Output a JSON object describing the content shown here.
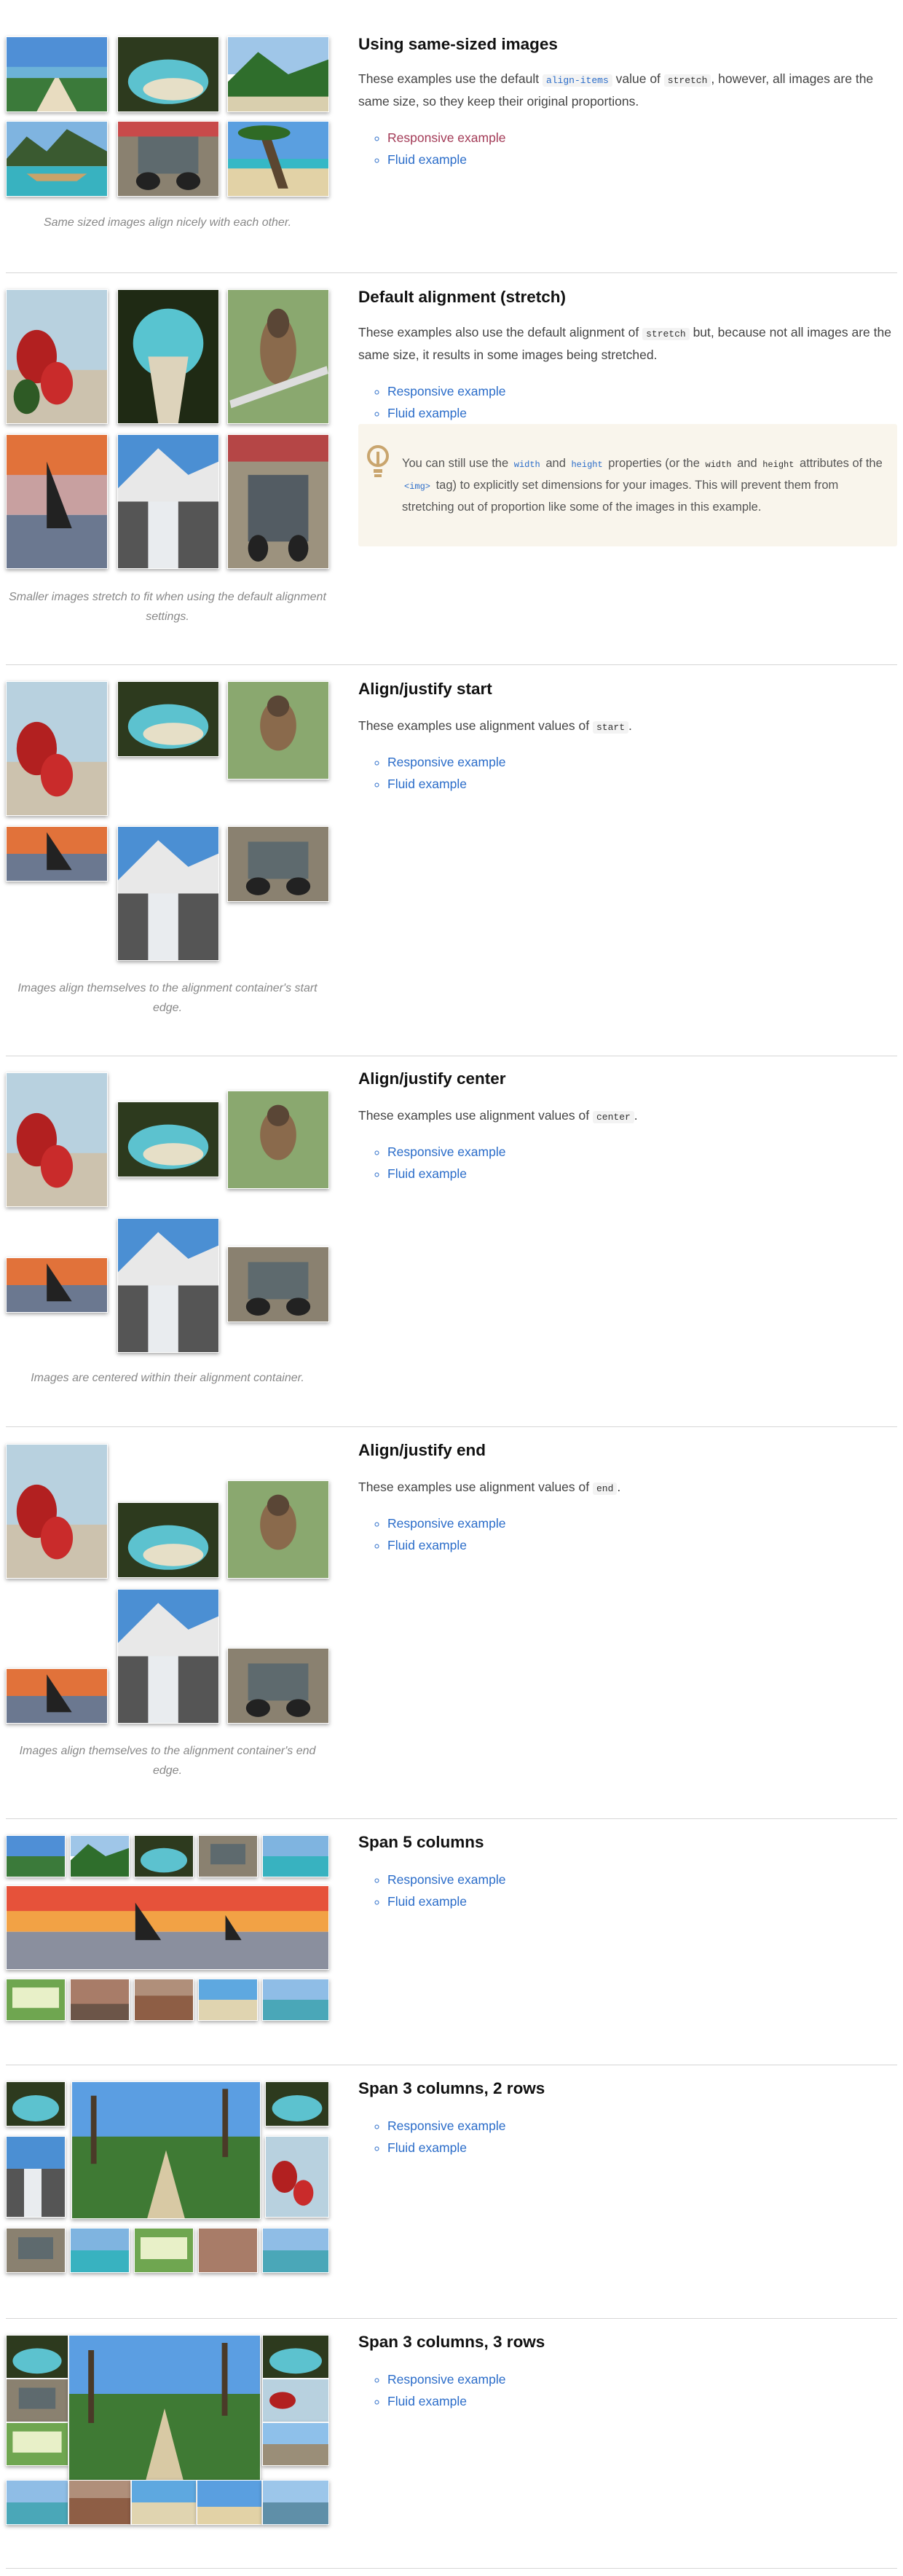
{
  "sections": [
    {
      "title": "Using same-sized images",
      "desc_pre": "These examples use the default ",
      "desc_code1": "align-items",
      "desc_mid": " value of ",
      "desc_code2": "stretch",
      "desc_post": ", however, all images are the same size, so they keep their original proportions.",
      "links": [
        "Responsive example",
        "Fluid example"
      ],
      "caption": "Same sized images align nicely with each other."
    },
    {
      "title": "Default alignment (stretch)",
      "desc_pre": "These examples also use the default alignment of ",
      "desc_code1": "stretch",
      "desc_post": " but, because not all images are the same size, it results in some images being stretched.",
      "links": [
        "Responsive example",
        "Fluid example"
      ],
      "note": {
        "pre": "You can still use the ",
        "c1": "width",
        "m1": " and ",
        "c2": "height",
        "m2": " properties (or the ",
        "c3": "width",
        "m3": " and ",
        "c4": "height",
        "m4": " attributes of the ",
        "c5": "<img>",
        "post": " tag) to explicitly set dimensions for your images. This will prevent them from stretching out of proportion like some of the images in this example."
      },
      "caption": "Smaller images stretch to fit when using the default alignment settings."
    },
    {
      "title": "Align/justify start",
      "desc_pre": "These examples use alignment values of ",
      "desc_code1": "start",
      "desc_post": ".",
      "links": [
        "Responsive example",
        "Fluid example"
      ],
      "caption": "Images align themselves to the alignment container's start edge."
    },
    {
      "title": "Align/justify center",
      "desc_pre": "These examples use alignment values of ",
      "desc_code1": "center",
      "desc_post": ".",
      "links": [
        "Responsive example",
        "Fluid example"
      ],
      "caption": "Images are centered within their alignment container."
    },
    {
      "title": "Align/justify end",
      "desc_pre": "These examples use alignment values of ",
      "desc_code1": "end",
      "desc_post": ".",
      "links": [
        "Responsive example",
        "Fluid example"
      ],
      "caption": "Images align themselves to the alignment container's end edge."
    },
    {
      "title": "Span 5 columns",
      "links": [
        "Responsive example",
        "Fluid example"
      ]
    },
    {
      "title": "Span 3 columns, 2 rows",
      "links": [
        "Responsive example",
        "Fluid example"
      ]
    },
    {
      "title": "Span 3 columns, 3 rows",
      "links": [
        "Responsive example",
        "Fluid example"
      ]
    }
  ],
  "colors": {
    "link": "#2a6cc9",
    "visited_link": "#a33b57",
    "note_bg": "#f9f5ec",
    "divider": "#d6d6d6"
  },
  "icons": [
    "lightbulb-icon"
  ]
}
